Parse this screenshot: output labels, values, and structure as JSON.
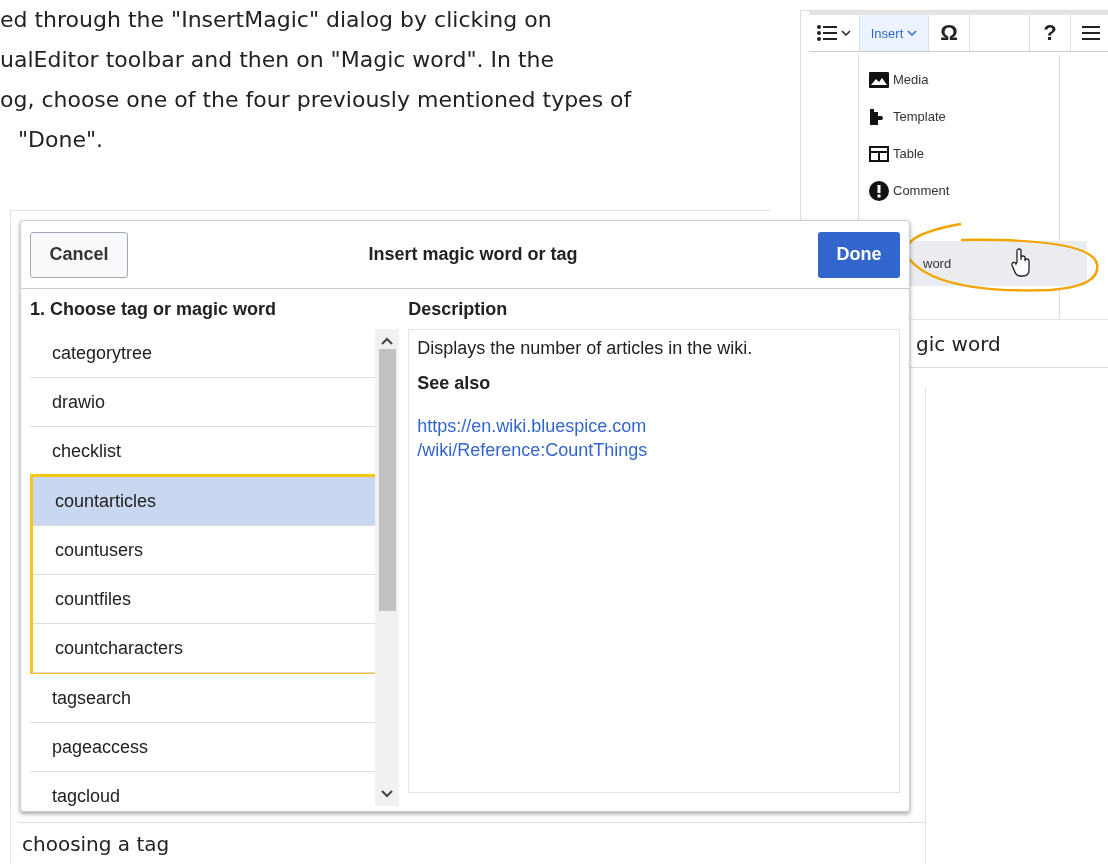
{
  "paragraph_lines": [
    "ed through the \"InsertMagic\" dialog by clicking on",
    "ualEditor toolbar and then on \"Magic word\". In the",
    "og, choose one of the four previously mentioned types of",
    "\"Done\"."
  ],
  "toolbar_figure": {
    "toolbar": {
      "insert_label": "Insert",
      "omega": "Ω",
      "help": "?"
    },
    "menu": [
      {
        "label": "Media",
        "kind": "media",
        "selected": false
      },
      {
        "label": "Template",
        "kind": "template",
        "selected": false
      },
      {
        "label": "Table",
        "kind": "table",
        "selected": false
      },
      {
        "label": "Comment",
        "kind": "comment",
        "selected": false
      },
      {
        "label": "word",
        "kind": "magic",
        "selected": true
      }
    ],
    "caption": "gic word"
  },
  "dialog": {
    "cancel": "Cancel",
    "title": "Insert magic word or tag",
    "done": "Done",
    "list_heading": "1. Choose tag or magic word",
    "items": [
      {
        "label": "categorytree",
        "selected": false,
        "framed": false
      },
      {
        "label": "drawio",
        "selected": false,
        "framed": false
      },
      {
        "label": "checklist",
        "selected": false,
        "framed": false
      },
      {
        "label": "countarticles",
        "selected": true,
        "framed": true
      },
      {
        "label": "countusers",
        "selected": false,
        "framed": true
      },
      {
        "label": "countfiles",
        "selected": false,
        "framed": true
      },
      {
        "label": "countcharacters",
        "selected": false,
        "framed": true
      },
      {
        "label": "tagsearch",
        "selected": false,
        "framed": false
      },
      {
        "label": "pageaccess",
        "selected": false,
        "framed": false
      },
      {
        "label": "tagcloud",
        "selected": false,
        "framed": false
      }
    ],
    "description_heading": "Description",
    "description": "Displays the number of articles in the wiki.",
    "see_also": "See also",
    "link_lines": [
      "https://en.wiki.bluespice.com",
      "/wiki/Reference:CountThings"
    ]
  },
  "caption": "choosing a tag"
}
